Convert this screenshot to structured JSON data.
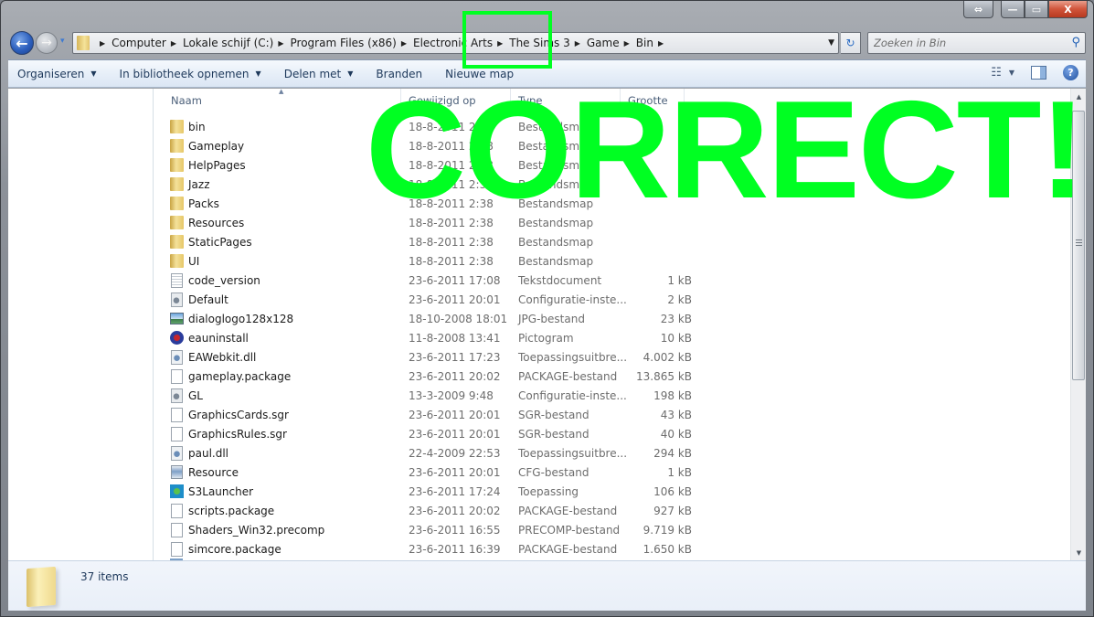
{
  "window": {
    "caption_buttons": {
      "snap": "⇔",
      "minimize": "—",
      "maximize": "▭",
      "close": "X"
    }
  },
  "nav": {
    "back_icon": "←",
    "forward_icon": "→",
    "recent_icon": "▾",
    "breadcrumb": [
      "Computer",
      "Lokale schijf (C:)",
      "Program Files (x86)",
      "Electronic Arts",
      "The Sims 3",
      "Game",
      "Bin"
    ],
    "crumb_separator": "▶",
    "address_dropdown": "▼",
    "refresh_icon": "↻",
    "search_placeholder": "Zoeken in Bin",
    "search_icon": "⚲"
  },
  "toolbar": {
    "buttons": [
      {
        "label": "Organiseren",
        "has_dropdown": true
      },
      {
        "label": "In bibliotheek opnemen",
        "has_dropdown": true
      },
      {
        "label": "Delen met",
        "has_dropdown": true
      },
      {
        "label": "Branden",
        "has_dropdown": false
      },
      {
        "label": "Nieuwe map",
        "has_dropdown": false
      }
    ],
    "caret": "▼",
    "view_icon": "☷",
    "help_icon": "?"
  },
  "columns": {
    "name": "Naam",
    "date": "Gewijzigd op",
    "type": "Type",
    "size": "Grootte",
    "sort_indicator": "▲"
  },
  "files": [
    {
      "name": "bin",
      "date": "18-8-2011 2:38",
      "type": "Bestandsmap",
      "size": "",
      "icon": "folder"
    },
    {
      "name": "Gameplay",
      "date": "18-8-2011 2:38",
      "type": "Bestandsmap",
      "size": "",
      "icon": "folder"
    },
    {
      "name": "HelpPages",
      "date": "18-8-2011 2:38",
      "type": "Bestandsmap",
      "size": "",
      "icon": "folder"
    },
    {
      "name": "Jazz",
      "date": "18-8-2011 2:38",
      "type": "Bestandsmap",
      "size": "",
      "icon": "folder"
    },
    {
      "name": "Packs",
      "date": "18-8-2011 2:38",
      "type": "Bestandsmap",
      "size": "",
      "icon": "folder"
    },
    {
      "name": "Resources",
      "date": "18-8-2011 2:38",
      "type": "Bestandsmap",
      "size": "",
      "icon": "folder"
    },
    {
      "name": "StaticPages",
      "date": "18-8-2011 2:38",
      "type": "Bestandsmap",
      "size": "",
      "icon": "folder"
    },
    {
      "name": "UI",
      "date": "18-8-2011 2:38",
      "type": "Bestandsmap",
      "size": "",
      "icon": "folder"
    },
    {
      "name": "code_version",
      "date": "23-6-2011 17:08",
      "type": "Tekstdocument",
      "size": "1 kB",
      "icon": "text"
    },
    {
      "name": "Default",
      "date": "23-6-2011 20:01",
      "type": "Configuratie-inste...",
      "size": "2 kB",
      "icon": "config"
    },
    {
      "name": "dialoglogo128x128",
      "date": "18-10-2008 18:01",
      "type": "JPG-bestand",
      "size": "23 kB",
      "icon": "image"
    },
    {
      "name": "eauninstall",
      "date": "11-8-2008 13:41",
      "type": "Pictogram",
      "size": "10 kB",
      "icon": "ea"
    },
    {
      "name": "EAWebkit.dll",
      "date": "23-6-2011 17:23",
      "type": "Toepassingsuitbre...",
      "size": "4.002 kB",
      "icon": "dll"
    },
    {
      "name": "gameplay.package",
      "date": "23-6-2011 20:02",
      "type": "PACKAGE-bestand",
      "size": "13.865 kB",
      "icon": "doc"
    },
    {
      "name": "GL",
      "date": "13-3-2009 9:48",
      "type": "Configuratie-inste...",
      "size": "198 kB",
      "icon": "config"
    },
    {
      "name": "GraphicsCards.sgr",
      "date": "23-6-2011 20:01",
      "type": "SGR-bestand",
      "size": "43 kB",
      "icon": "doc"
    },
    {
      "name": "GraphicsRules.sgr",
      "date": "23-6-2011 20:01",
      "type": "SGR-bestand",
      "size": "40 kB",
      "icon": "doc"
    },
    {
      "name": "paul.dll",
      "date": "22-4-2009 22:53",
      "type": "Toepassingsuitbre...",
      "size": "294 kB",
      "icon": "dll"
    },
    {
      "name": "Resource",
      "date": "23-6-2011 20:01",
      "type": "CFG-bestand",
      "size": "1 kB",
      "icon": "cfg"
    },
    {
      "name": "S3Launcher",
      "date": "23-6-2011 17:24",
      "type": "Toepassing",
      "size": "106 kB",
      "icon": "exe"
    },
    {
      "name": "scripts.package",
      "date": "23-6-2011 20:02",
      "type": "PACKAGE-bestand",
      "size": "927 kB",
      "icon": "doc"
    },
    {
      "name": "Shaders_Win32.precomp",
      "date": "23-6-2011 16:55",
      "type": "PRECOMP-bestand",
      "size": "9.719 kB",
      "icon": "doc"
    },
    {
      "name": "simcore.package",
      "date": "23-6-2011 16:39",
      "type": "PACKAGE-bestand",
      "size": "1.650 kB",
      "icon": "doc"
    }
  ],
  "scrollbar": {
    "up": "▲",
    "down": "▼"
  },
  "details": {
    "item_count": "37 items"
  },
  "overlay": {
    "text": "CORRECT!",
    "color": "#00ff22",
    "highlighted_crumb": "The Sims 3"
  }
}
